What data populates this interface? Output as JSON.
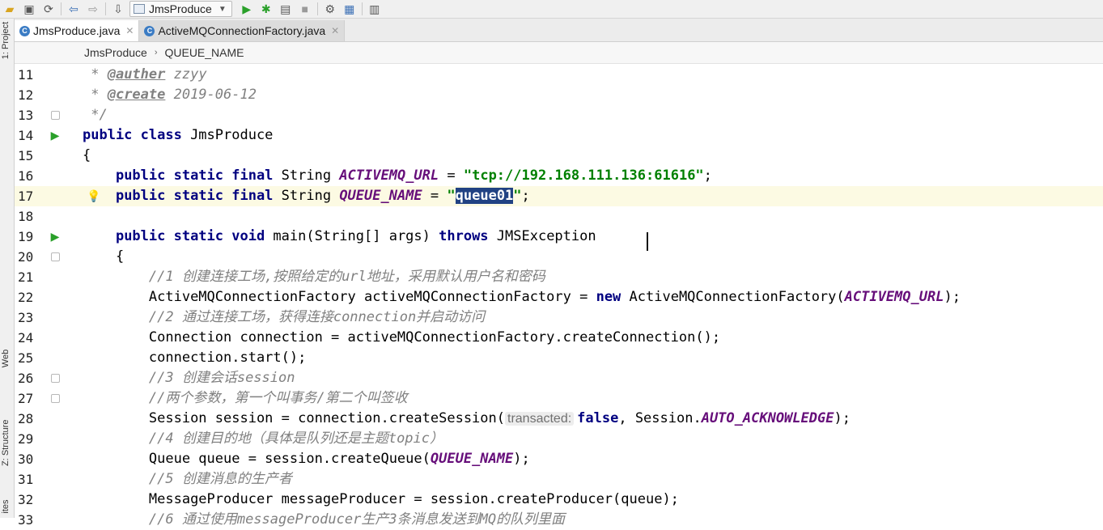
{
  "toolbar": {
    "run_config": "JmsProduce",
    "icons": [
      "open-folder-icon",
      "save-icon",
      "sync-icon",
      "back-icon",
      "forward-icon",
      "build-icon",
      "run-icon",
      "debug-icon",
      "coverage-icon",
      "stop-icon",
      "project-structure-icon",
      "sdk-icon",
      "deploy-icon"
    ]
  },
  "side_panel": {
    "project": "1: Project",
    "web": "Web",
    "structure": "Z: Structure",
    "favorites": "ites"
  },
  "tabs": [
    {
      "label": "JmsProduce.java",
      "active": true
    },
    {
      "label": "ActiveMQConnectionFactory.java",
      "active": false
    }
  ],
  "breadcrumb": {
    "class_name": "JmsProduce",
    "field": "QUEUE_NAME"
  },
  "editor": {
    "line_numbers": [
      "11",
      "12",
      "13",
      "14",
      "15",
      "16",
      "17",
      "18",
      "19",
      "20",
      "21",
      "22",
      "23",
      "24",
      "25",
      "26",
      "27",
      "28",
      "29",
      "30",
      "31",
      "32",
      "33"
    ],
    "l11": {
      "star": " * ",
      "tag": "@auther",
      "val": " zzyy"
    },
    "l12": {
      "star": " * ",
      "tag": "@create",
      "val": " 2019-06-12"
    },
    "l13": {
      "text": " */"
    },
    "l14": {
      "kw": "public class",
      "rest": " JmsProduce"
    },
    "l15": {
      "text": "{"
    },
    "l16": {
      "kw": "public static final",
      "type": " String ",
      "const": "ACTIVEMQ_URL",
      "eq": " = ",
      "str": "\"tcp://192.168.111.136:61616\"",
      "end": ";"
    },
    "l17": {
      "kw": "public static final",
      "type": " String ",
      "const": "QUEUE_NAME",
      "eq": " = ",
      "q1": "\"",
      "sel": "queue01",
      "q2": "\"",
      "end": ";"
    },
    "l19": {
      "kw": "public static void",
      "mid": " main(String[] args) ",
      "kw2": "throws",
      "rest": " JMSException"
    },
    "l20": {
      "text": "{"
    },
    "l21": {
      "cmt": "//1 创建连接工场,按照给定的url地址，采用默认用户名和密码"
    },
    "l22": {
      "a": "ActiveMQConnectionFactory activeMQConnectionFactory = ",
      "kw": "new",
      "b": " ActiveMQConnectionFactory(",
      "const": "ACTIVEMQ_URL",
      "end": ");"
    },
    "l23": {
      "cmt": "//2 通过连接工场，获得连接connection并启动访问"
    },
    "l24": {
      "text": "Connection connection = activeMQConnectionFactory.createConnection();"
    },
    "l25": {
      "text": "connection.start();"
    },
    "l26": {
      "cmt": "//3 创建会话session"
    },
    "l27": {
      "cmt": "//两个参数，第一个叫事务/第二个叫签收"
    },
    "l28": {
      "a": "Session session = connection.createSession(",
      "hint": "transacted:",
      "kw": "false",
      "b": ", Session.",
      "const": "AUTO_ACKNOWLEDGE",
      "end": ");"
    },
    "l29": {
      "cmt": "//4 创建目的地（具体是队列还是主题topic）"
    },
    "l30": {
      "a": "Queue queue = session.createQueue(",
      "const": "QUEUE_NAME",
      "end": ");"
    },
    "l31": {
      "cmt": "//5 创建消息的生产者"
    },
    "l32": {
      "text": "MessageProducer messageProducer = session.createProducer(queue);"
    },
    "l33": {
      "cmt": "//6 通过使用messageProducer生产3条消息发送到MQ的队列里面"
    }
  },
  "colors": {
    "keyword": "#000080",
    "string": "#008000",
    "constant": "#660e7a",
    "comment": "#808080",
    "current_line": "#fcfae3",
    "selection": "#214283"
  }
}
